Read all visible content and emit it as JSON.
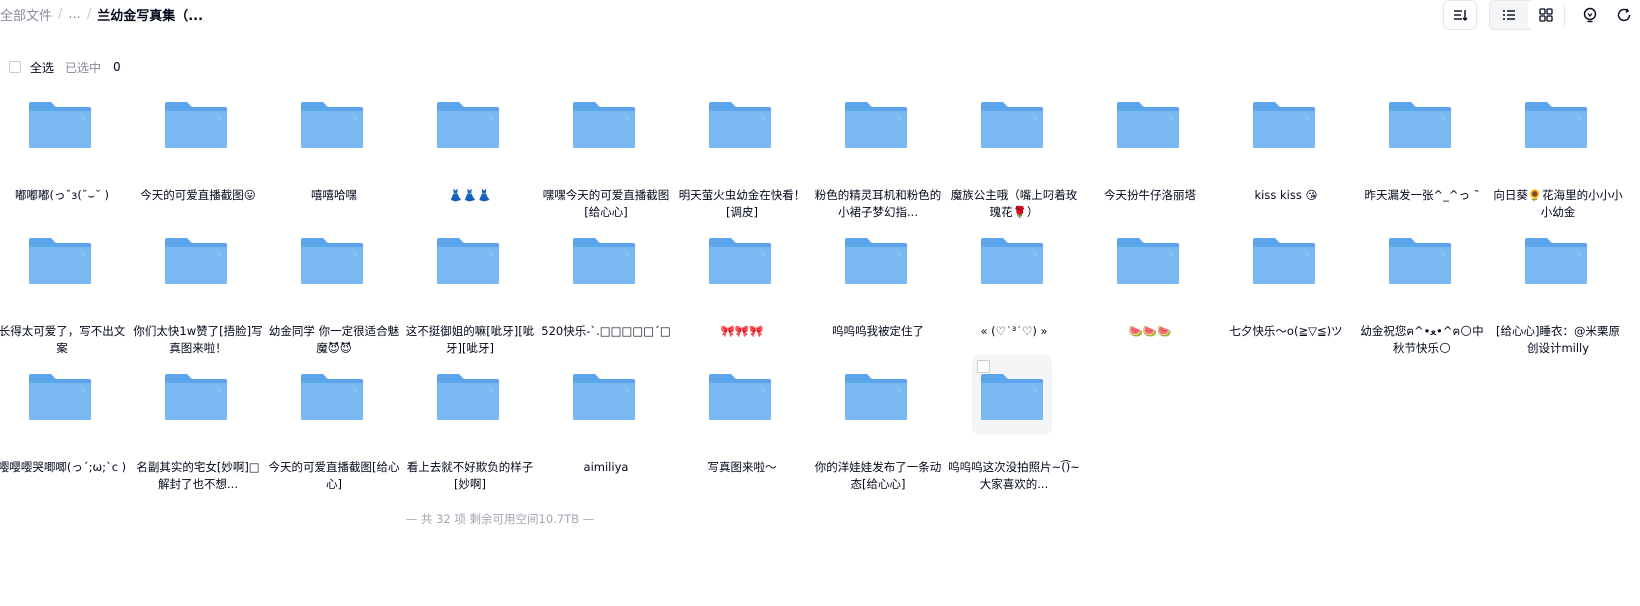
{
  "breadcrumb": {
    "root": "全部文件",
    "ellipsis": "...",
    "current": "兰幼金写真集（..."
  },
  "toolbar": {
    "icons": [
      "sort-icon",
      "list-view-icon",
      "grid-view-icon",
      "lightbulb-icon",
      "refresh-icon"
    ],
    "active_view": "grid"
  },
  "selection": {
    "select_all_label": "全选",
    "selected_label": "已选中",
    "selected_count": "0"
  },
  "folders": [
    {
      "name": "嘟嘟嘟(っ˘з(˘⌣˘ )"
    },
    {
      "name": "今天的可爱直播截图😛"
    },
    {
      "name": "嘻嘻哈嘿"
    },
    {
      "name": "👗👗👗"
    },
    {
      "name": "嘿嘿今天的可爱直播截图[给心心]"
    },
    {
      "name": "明天萤火虫幼金在快看！[调皮]"
    },
    {
      "name": "粉色的精灵耳机和粉色的小裙子梦幻指..."
    },
    {
      "name": "魔族公主哦（嘴上叼着玫瑰花🌹）"
    },
    {
      "name": "今天扮牛仔洛丽塔"
    },
    {
      "name": "kiss kiss 😘"
    },
    {
      "name": "昨天漏发一张^_^っ ˜"
    },
    {
      "name": "向日葵🌻花海里的小小小小幼金"
    },
    {
      "name": "长得太可爱了，写不出文案"
    },
    {
      "name": "你们太快1w赞了[捂脸]写真图来啦！"
    },
    {
      "name": "幼金同学 你一定很适合魅魔😈😈"
    },
    {
      "name": "这不挺御姐的嘛[呲牙][呲牙][呲牙]"
    },
    {
      "name": "520快乐-`.□□□□□´□"
    },
    {
      "name": "🎀🎀🎀"
    },
    {
      "name": "呜呜呜我被定住了"
    },
    {
      "name": "« (♡˙³˙♡) »"
    },
    {
      "name": "🍉🍉🍉"
    },
    {
      "name": "七夕快乐～o(≧▽≦)ツ"
    },
    {
      "name": "幼金祝您ฅ^•ﻌ•^ฅ🌕中秋节快乐🌕"
    },
    {
      "name": "[给心心]睡衣：@米栗原创设计milly"
    },
    {
      "name": "嘤嘤嘤哭唧唧(っ´;ω;`c )"
    },
    {
      "name": "名副其实的宅女[妙啊]□解封了也不想..."
    },
    {
      "name": "今天的可爱直播截图[给心心]"
    },
    {
      "name": "看上去就不好欺负的样子[妙啊]"
    },
    {
      "name": "aimiliya"
    },
    {
      "name": "写真图来啦～"
    },
    {
      "name": "你的洋娃娃发布了一条动态[给心心]"
    },
    {
      "name": "呜呜呜这次没拍照片~(͡)~ 大家喜欢的..."
    }
  ],
  "footer": "— 共 32 项 剩余可用空间10.7TB —",
  "colors": {
    "folder_front": "#79b8f0",
    "folder_back": "#5da5ea",
    "text": "#03081a",
    "muted": "#878c9c"
  }
}
